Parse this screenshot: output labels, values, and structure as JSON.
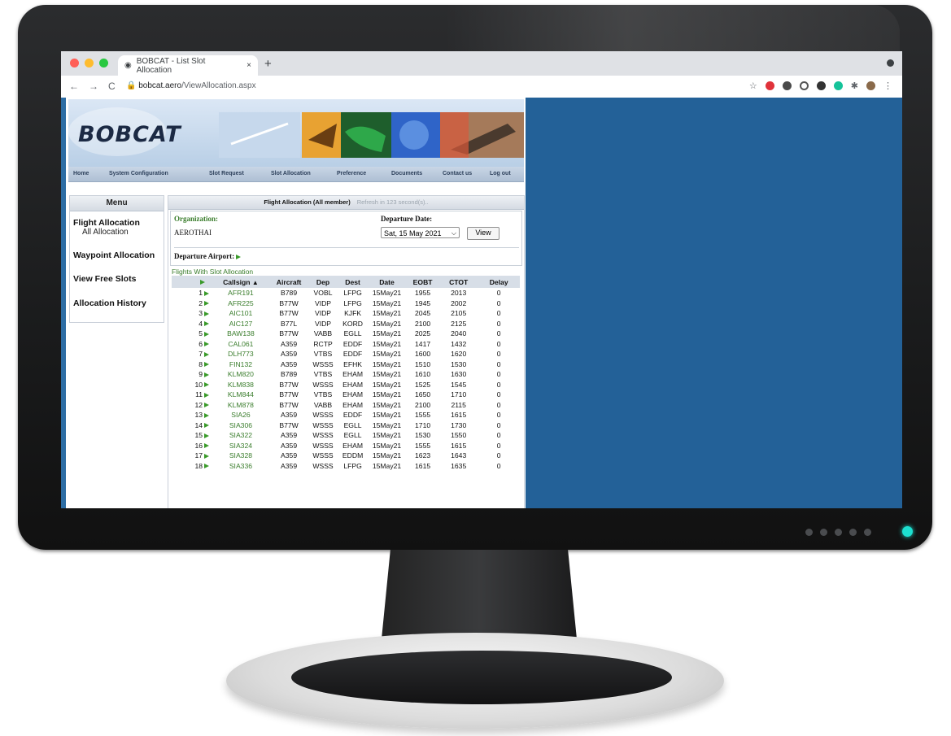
{
  "browser": {
    "tab_title": "BOBCAT - List Slot Allocation",
    "tab_close": "×",
    "new_tab": "+",
    "url_host": "bobcat.aero",
    "url_path": "/ViewAllocation.aspx",
    "back": "←",
    "forward": "→",
    "reload": "C"
  },
  "site": {
    "logo": "BOBCAT",
    "nav": [
      "Home",
      "System Configuration",
      "Slot Request",
      "Slot Allocation",
      "Preference",
      "Documents",
      "Contact us",
      "Log out"
    ]
  },
  "menu": {
    "title": "Menu",
    "items": [
      {
        "label": "Flight Allocation",
        "sub": "All Allocation"
      },
      {
        "label": "Waypoint Allocation"
      },
      {
        "label": "View Free Slots"
      },
      {
        "label": "Allocation History"
      }
    ]
  },
  "allocation": {
    "title": "Flight Allocation (All member)",
    "refresh": "Refresh in 123 second(s)..",
    "organization_label": "Organization:",
    "organization_value": "AEROTHAI",
    "departure_date_label": "Departure Date:",
    "departure_date_value": "Sat, 15 May 2021",
    "view_button": "View",
    "departure_airport_label": "Departure Airport:",
    "caption": "Flights With Slot Allocation",
    "columns": [
      "Callsign",
      "Aircraft",
      "Dep",
      "Dest",
      "Date",
      "EOBT",
      "CTOT",
      "Delay"
    ],
    "rows": [
      [
        "1",
        "AFR191",
        "B789",
        "VOBL",
        "LFPG",
        "15May21",
        "1955",
        "2013",
        "0"
      ],
      [
        "2",
        "AFR225",
        "B77W",
        "VIDP",
        "LFPG",
        "15May21",
        "1945",
        "2002",
        "0"
      ],
      [
        "3",
        "AIC101",
        "B77W",
        "VIDP",
        "KJFK",
        "15May21",
        "2045",
        "2105",
        "0"
      ],
      [
        "4",
        "AIC127",
        "B77L",
        "VIDP",
        "KORD",
        "15May21",
        "2100",
        "2125",
        "0"
      ],
      [
        "5",
        "BAW138",
        "B77W",
        "VABB",
        "EGLL",
        "15May21",
        "2025",
        "2040",
        "0"
      ],
      [
        "6",
        "CAL061",
        "A359",
        "RCTP",
        "EDDF",
        "15May21",
        "1417",
        "1432",
        "0"
      ],
      [
        "7",
        "DLH773",
        "A359",
        "VTBS",
        "EDDF",
        "15May21",
        "1600",
        "1620",
        "0"
      ],
      [
        "8",
        "FIN132",
        "A359",
        "WSSS",
        "EFHK",
        "15May21",
        "1510",
        "1530",
        "0"
      ],
      [
        "9",
        "KLM820",
        "B789",
        "VTBS",
        "EHAM",
        "15May21",
        "1610",
        "1630",
        "0"
      ],
      [
        "10",
        "KLM838",
        "B77W",
        "WSSS",
        "EHAM",
        "15May21",
        "1525",
        "1545",
        "0"
      ],
      [
        "11",
        "KLM844",
        "B77W",
        "VTBS",
        "EHAM",
        "15May21",
        "1650",
        "1710",
        "0"
      ],
      [
        "12",
        "KLM878",
        "B77W",
        "VABB",
        "EHAM",
        "15May21",
        "2100",
        "2115",
        "0"
      ],
      [
        "13",
        "SIA26",
        "A359",
        "WSSS",
        "EDDF",
        "15May21",
        "1555",
        "1615",
        "0"
      ],
      [
        "14",
        "SIA306",
        "B77W",
        "WSSS",
        "EGLL",
        "15May21",
        "1710",
        "1730",
        "0"
      ],
      [
        "15",
        "SIA322",
        "A359",
        "WSSS",
        "EGLL",
        "15May21",
        "1530",
        "1550",
        "0"
      ],
      [
        "16",
        "SIA324",
        "A359",
        "WSSS",
        "EHAM",
        "15May21",
        "1555",
        "1615",
        "0"
      ],
      [
        "17",
        "SIA328",
        "A359",
        "WSSS",
        "EDDM",
        "15May21",
        "1623",
        "1643",
        "0"
      ],
      [
        "18",
        "SIA336",
        "A359",
        "WSSS",
        "LFPG",
        "15May21",
        "1615",
        "1635",
        "0"
      ]
    ]
  }
}
